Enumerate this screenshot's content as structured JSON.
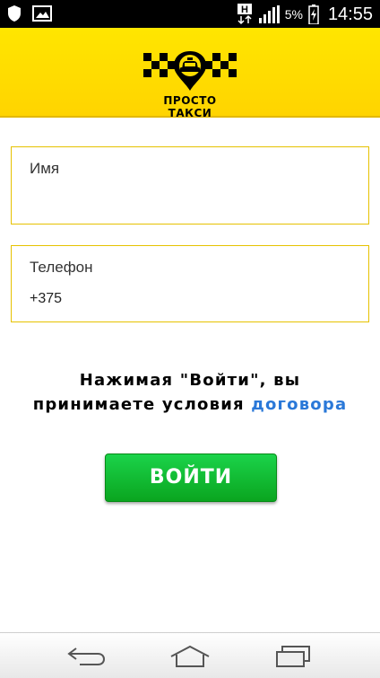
{
  "status_bar": {
    "battery_percent": "5%",
    "time": "14:55",
    "network_label": "H",
    "icons": [
      "shield-icon",
      "image-icon",
      "network-h-icon",
      "signal-icon",
      "battery-charging-icon"
    ]
  },
  "header": {
    "logo_text": "ПРОСТО ТАКСИ",
    "background_color": "#ffdd00"
  },
  "form": {
    "name_label": "Имя",
    "phone_label": "Телефон",
    "phone_value": "+375"
  },
  "terms": {
    "line1": "Нажимая \"Войти\", вы",
    "line2_prefix": "принимаете условия",
    "link_text": "договора",
    "link_color": "#2a78d8"
  },
  "login_button": {
    "label": "ВОЙТИ",
    "color": "#12bb33"
  },
  "nav": {
    "items": [
      "back-icon",
      "home-icon",
      "recent-apps-icon"
    ]
  }
}
